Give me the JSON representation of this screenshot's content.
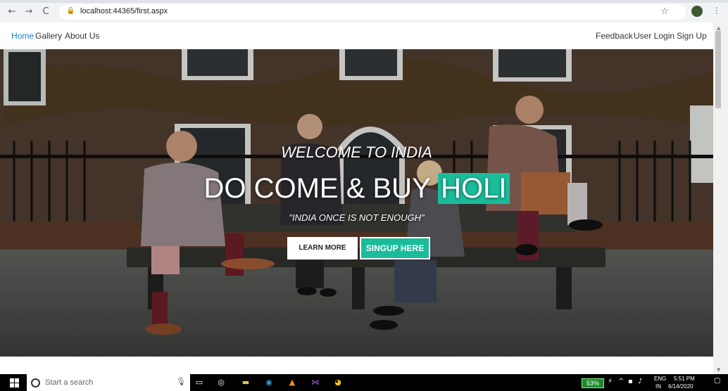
{
  "browser": {
    "url": "localhost:44365/first.aspx",
    "back_icon": "←",
    "forward_icon": "→",
    "reload_icon": "C",
    "lock_icon": "🔒",
    "star_icon": "☆",
    "menu_icon": "⋮"
  },
  "nav": {
    "left": [
      "Home",
      "Gallery",
      "About Us"
    ],
    "right": [
      "Feedback",
      "User Login",
      "Sign Up"
    ],
    "active_color": "#1a7fd6"
  },
  "hero": {
    "welcome": "WELCOME TO INDIA",
    "headline_main": "DO COME & BUY",
    "headline_highlight": "HOLI",
    "quote": "\"INDIA ONCE IS NOT ENOUGH\"",
    "learn_more": "LEARN MORE",
    "signup": "SINGUP HERE",
    "accent_color": "#1abc9c"
  },
  "taskbar": {
    "search_placeholder": "Start a search",
    "battery": "53%",
    "language_top": "ENG",
    "language_bottom": "IN",
    "time": "5:51 PM",
    "date": "6/14/2020"
  }
}
